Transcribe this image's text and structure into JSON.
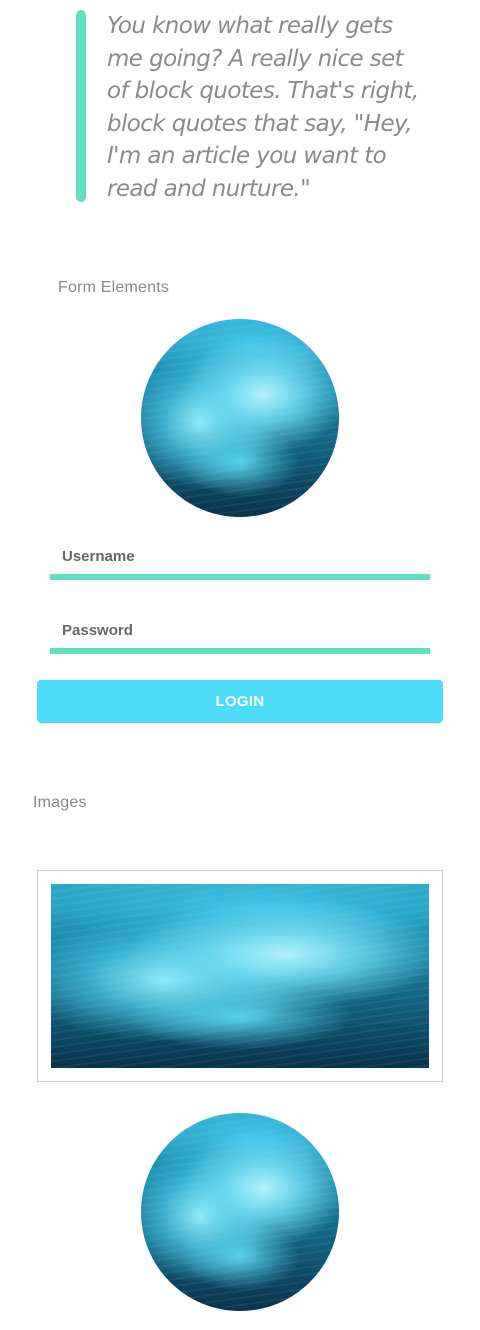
{
  "blockquote": {
    "text": "You know what really gets me going? A really nice set of block quotes. That's right, block quotes that say, \"Hey, I'm an article you want to read and nurture.\""
  },
  "form_section": {
    "heading": "Form Elements",
    "username_placeholder": "Username",
    "password_placeholder": "Password",
    "login_label": "LOGIN"
  },
  "images_section": {
    "heading": "Images"
  },
  "colors": {
    "accent_teal": "#5ee0c1",
    "accent_cyan": "#4ddcfa"
  }
}
